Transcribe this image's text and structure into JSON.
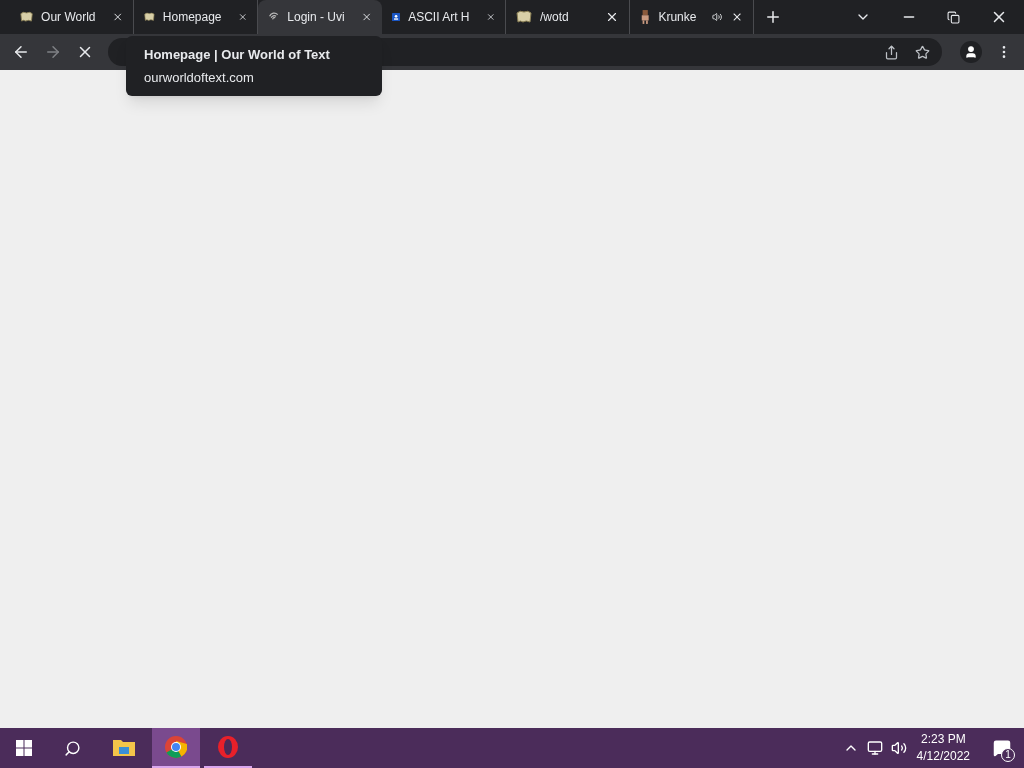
{
  "tabs": [
    {
      "title": "Our World",
      "kind": "scroll",
      "selected": false,
      "audio": false
    },
    {
      "title": "Homepage",
      "kind": "scroll",
      "selected": false,
      "audio": false
    },
    {
      "title": "Login - Uvi",
      "kind": "swirl",
      "selected": true,
      "audio": false
    },
    {
      "title": "ASCII Art H",
      "kind": "badge",
      "selected": false,
      "audio": false
    },
    {
      "title": "/wotd",
      "kind": "scroll",
      "selected": false,
      "audio": false
    },
    {
      "title": "Krunke",
      "kind": "figure",
      "selected": false,
      "audio": true
    }
  ],
  "toolbar": {
    "loading": true
  },
  "tooltip": {
    "title": "Homepage | Our World of Text",
    "url": "ourworldoftext.com"
  },
  "taskbar": {
    "apps": [
      {
        "kind": "explorer",
        "selected": false,
        "running": false
      },
      {
        "kind": "chrome",
        "selected": true,
        "running": true
      },
      {
        "kind": "opera",
        "selected": false,
        "running": true
      }
    ],
    "time": "2:23 PM",
    "date": "4/12/2022",
    "notifications": "1"
  }
}
